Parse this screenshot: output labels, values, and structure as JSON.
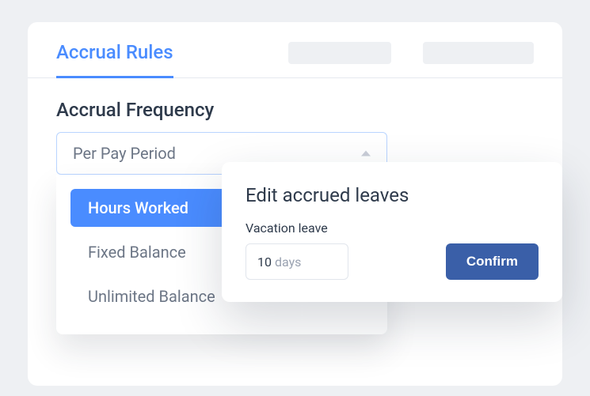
{
  "tabs": {
    "active": "Accrual Rules"
  },
  "section": {
    "title": "Accrual Frequency"
  },
  "select": {
    "value": "Per Pay Period",
    "options": [
      "Hours Worked",
      "Fixed Balance",
      "Unlimited Balance"
    ],
    "selected_index": 0
  },
  "modal": {
    "title": "Edit accrued leaves",
    "label": "Vacation leave",
    "value": "10",
    "unit": "days",
    "confirm": "Confirm"
  }
}
